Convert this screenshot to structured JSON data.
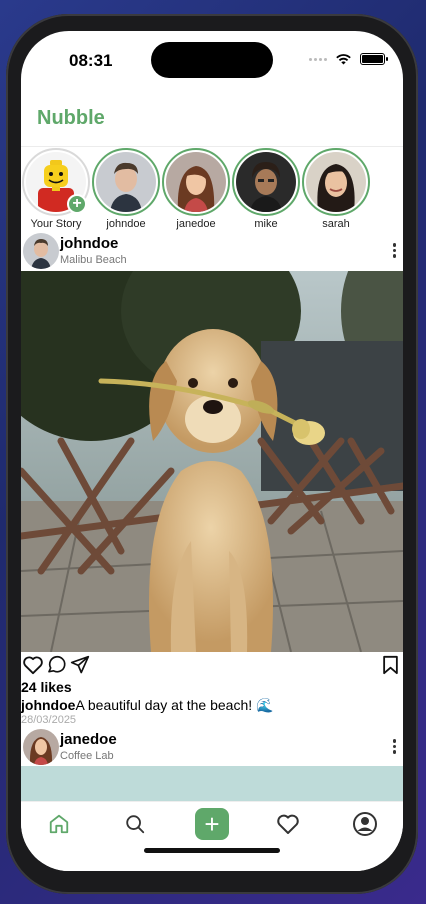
{
  "status_bar": {
    "time": "08:31"
  },
  "app": {
    "title": "Nubble",
    "accent_color": "#5fa86a"
  },
  "stories": [
    {
      "label": "Your Story",
      "avatar": "lego-figure-avatar",
      "own": true
    },
    {
      "label": "johndoe",
      "avatar": "user-avatar"
    },
    {
      "label": "janedoe",
      "avatar": "user-avatar"
    },
    {
      "label": "mike",
      "avatar": "user-avatar"
    },
    {
      "label": "sarah",
      "avatar": "user-avatar"
    }
  ],
  "post": {
    "username": "johndoe",
    "location": "Malibu Beach",
    "image": "golden-retriever-with-flower-photo",
    "likes": "24 likes",
    "caption_user": "johndoe",
    "caption_text": "A beautiful day at the beach! 🌊",
    "date": "28/03/2025"
  },
  "post2": {
    "username": "janedoe",
    "location": "Coffee Lab",
    "preview_color": "#bedbd9"
  },
  "tabbar": {
    "items": [
      "home-icon",
      "search-icon",
      "add-icon",
      "heart-icon",
      "profile-icon"
    ],
    "add_label": "+"
  },
  "icons": {
    "post_actions": [
      "heart-icon",
      "comment-icon",
      "send-icon"
    ],
    "bookmark": "bookmark-icon",
    "more": "more-vertical-icon"
  }
}
